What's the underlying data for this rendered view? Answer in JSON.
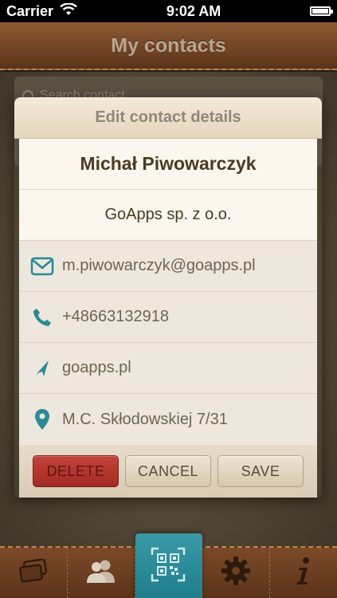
{
  "status_bar": {
    "carrier": "Carrier",
    "time": "9:02 AM",
    "battery_level": 1.0
  },
  "nav": {
    "title": "My contacts"
  },
  "search": {
    "placeholder": "Search contact"
  },
  "dialog": {
    "title": "Edit contact details",
    "name": "Michał Piwowarczyk",
    "company": "GoApps sp. z o.o.",
    "fields": [
      {
        "icon": "mail-icon",
        "value": "m.piwowarczyk@goapps.pl"
      },
      {
        "icon": "phone-icon",
        "value": "+48663132918"
      },
      {
        "icon": "location-arrow-icon",
        "value": "goapps.pl"
      },
      {
        "icon": "map-pin-icon",
        "value": "M.C. Skłodowskiej 7/31"
      }
    ],
    "buttons": {
      "delete": "DELETE",
      "cancel": "CANCEL",
      "save": "SAVE"
    }
  },
  "tabs": [
    {
      "icon": "cards-icon"
    },
    {
      "icon": "contacts-icon"
    },
    {
      "icon": "qr-code-icon",
      "active": true
    },
    {
      "icon": "gear-icon"
    },
    {
      "icon": "info-icon"
    }
  ],
  "colors": {
    "accent_teal": "#2a8a98",
    "delete_red": "#b3352e",
    "leather_brown": "#6a3f22"
  }
}
